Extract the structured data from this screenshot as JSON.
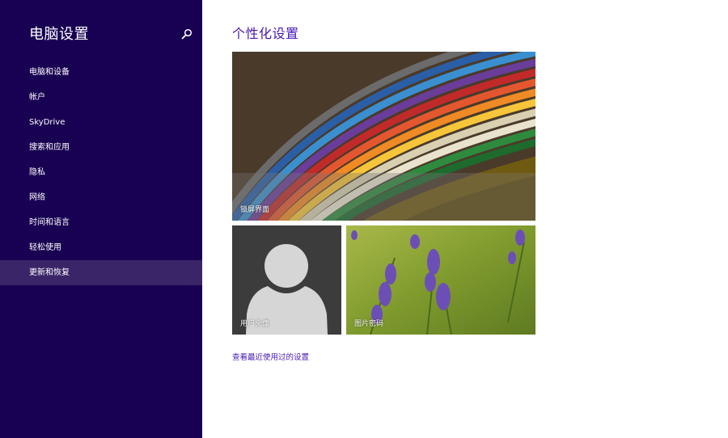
{
  "sidebar": {
    "title": "电脑设置",
    "search_icon": "search-icon",
    "items": [
      {
        "label": "电脑和设备",
        "selected": false
      },
      {
        "label": "帐户",
        "selected": false
      },
      {
        "label": "SkyDrive",
        "selected": false
      },
      {
        "label": "搜索和应用",
        "selected": false
      },
      {
        "label": "隐私",
        "selected": false
      },
      {
        "label": "网络",
        "selected": false
      },
      {
        "label": "时间和语言",
        "selected": false
      },
      {
        "label": "轻松使用",
        "selected": false
      },
      {
        "label": "更新和恢复",
        "selected": true
      }
    ]
  },
  "main": {
    "title": "个性化设置",
    "tiles": {
      "lock_screen": {
        "label": "锁屏界面"
      },
      "avatar": {
        "label": "用户头像"
      },
      "picture_password": {
        "label": "图片密码"
      }
    },
    "recent_link": "查看最近使用过的设置"
  },
  "colors": {
    "sidebar_bg": "#180052",
    "selected_bg": "#3a2568",
    "accent": "#4617b4"
  }
}
